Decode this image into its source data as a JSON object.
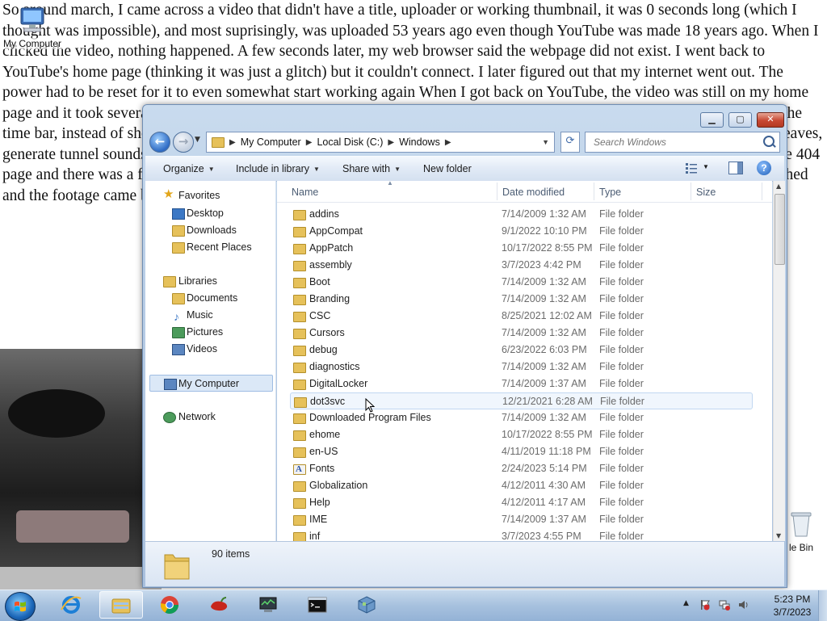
{
  "desktop": {
    "background_text": "So around march, I came across a video that didn't have a title, uploader or working thumbnail, it was 0 seconds long (which I thought was impossible), and most suprisingly, was uploaded 53 years ago even though YouTube was made 18 years ago. When I clicked the video, nothing happened. A few seconds later, my web browser said the webpage did not exist. I went back to YouTube's home page (thinking it was just a glitch) but it couldn't connect. I later figured out that my internet went out. The power had to be reset for it to even somewhat start working again When I got back on YouTube, the video was still on my home page and it took several tries for it to even start to load, even giving the error message several times before finally loading. The time bar, instead of showing --:-- or a time, had strange characters. The video showed footage of a camera spinning around leaves, generate tunnel sounds and then the audio stopped, the sound of breathing played at the same volume overtime. I checked the 404 page and there was a file called \"clip0563.avi\" from the webcam footage, 3 seconds in the camera fell to the ground, it switched and the footage came back in a visible in the player, I managed to take",
    "icons": [
      {
        "label": "My Computer",
        "icon": "computer-icon"
      },
      {
        "label": "le Bin",
        "icon": "recycle-bin-icon"
      }
    ]
  },
  "window": {
    "title": "Windows",
    "caption_buttons": {
      "minimize": "▁",
      "maximize": "▢",
      "close": "✕"
    },
    "address": {
      "crumbs": [
        "My Computer",
        "Local Disk (C:)",
        "Windows"
      ]
    },
    "search": {
      "placeholder": "Search Windows"
    },
    "toolbar": {
      "organize": "Organize",
      "include_in_library": "Include in library",
      "share_with": "Share with",
      "new_folder": "New folder"
    },
    "nav": {
      "favorites": "Favorites",
      "favorites_items": [
        "Desktop",
        "Downloads",
        "Recent Places"
      ],
      "libraries": "Libraries",
      "libraries_items": [
        "Documents",
        "Music",
        "Pictures",
        "Videos"
      ],
      "my_computer": "My Computer",
      "network": "Network"
    },
    "columns": {
      "name": "Name",
      "date": "Date modified",
      "type": "Type",
      "size": "Size"
    },
    "files": [
      {
        "name": "addins",
        "date": "7/14/2009 1:32 AM",
        "type": "File folder"
      },
      {
        "name": "AppCompat",
        "date": "9/1/2022 10:10 PM",
        "type": "File folder"
      },
      {
        "name": "AppPatch",
        "date": "10/17/2022 8:55 PM",
        "type": "File folder"
      },
      {
        "name": "assembly",
        "date": "3/7/2023 4:42 PM",
        "type": "File folder"
      },
      {
        "name": "Boot",
        "date": "7/14/2009 1:32 AM",
        "type": "File folder"
      },
      {
        "name": "Branding",
        "date": "7/14/2009 1:32 AM",
        "type": "File folder"
      },
      {
        "name": "CSC",
        "date": "8/25/2021 12:02 AM",
        "type": "File folder"
      },
      {
        "name": "Cursors",
        "date": "7/14/2009 1:32 AM",
        "type": "File folder"
      },
      {
        "name": "debug",
        "date": "6/23/2022 6:03 PM",
        "type": "File folder"
      },
      {
        "name": "diagnostics",
        "date": "7/14/2009 1:32 AM",
        "type": "File folder"
      },
      {
        "name": "DigitalLocker",
        "date": "7/14/2009 1:37 AM",
        "type": "File folder"
      },
      {
        "name": "dot3svc",
        "date": "12/21/2021 6:28 AM",
        "type": "File folder"
      },
      {
        "name": "Downloaded Program Files",
        "date": "7/14/2009 1:32 AM",
        "type": "File folder"
      },
      {
        "name": "ehome",
        "date": "10/17/2022 8:55 PM",
        "type": "File folder"
      },
      {
        "name": "en-US",
        "date": "4/11/2019 11:18 PM",
        "type": "File folder"
      },
      {
        "name": "Fonts",
        "date": "2/24/2023 5:14 PM",
        "type": "File folder"
      },
      {
        "name": "Globalization",
        "date": "4/12/2011 4:30 AM",
        "type": "File folder"
      },
      {
        "name": "Help",
        "date": "4/12/2011 4:17 AM",
        "type": "File folder"
      },
      {
        "name": "IME",
        "date": "7/14/2009 1:37 AM",
        "type": "File folder"
      },
      {
        "name": "inf",
        "date": "3/7/2023 4:55 PM",
        "type": "File folder"
      }
    ],
    "hovered_item": "dot3svc",
    "details": {
      "count": "90 items"
    }
  },
  "taskbar": {
    "apps": [
      "windows-explorer-icon",
      "internet-explorer-icon",
      "chrome-icon",
      "pepper-app-icon",
      "system-monitor-icon",
      "command-prompt-icon",
      "network-cube-icon"
    ],
    "clock": {
      "time": "5:23 PM",
      "date": "3/7/2023"
    }
  },
  "colors": {
    "window_frame": "#b8cde6",
    "selection": "#dbe8f7",
    "folder": "#e6c15a",
    "taskbar": "#a7c1de"
  }
}
